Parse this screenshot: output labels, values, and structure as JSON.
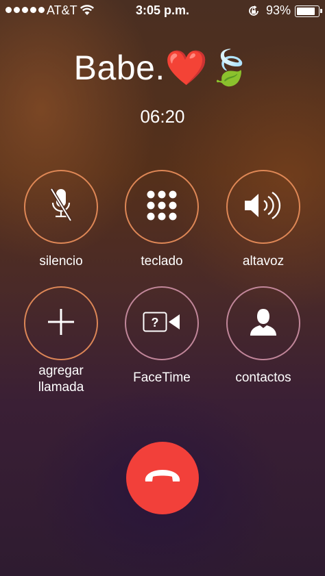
{
  "status_bar": {
    "carrier": "AT&T",
    "time": "3:05 p.m.",
    "battery_percent": "93%",
    "battery_level": 0.93,
    "signal_dots": 5
  },
  "call": {
    "caller_name": "Babe.❤️🍃",
    "duration": "06:20"
  },
  "buttons": [
    {
      "label": "silencio",
      "icon": "mute-icon"
    },
    {
      "label": "teclado",
      "icon": "keypad-icon"
    },
    {
      "label": "altavoz",
      "icon": "speaker-icon"
    },
    {
      "label": "agregar\nllamada",
      "icon": "add-icon"
    },
    {
      "label": "FaceTime",
      "icon": "facetime-icon"
    },
    {
      "label": "contactos",
      "icon": "contact-icon"
    }
  ],
  "end_call": {
    "icon": "end-call-icon",
    "color": "#f2403a"
  },
  "colors": {
    "ring": "#e68c5a",
    "end_call": "#f2403a"
  }
}
